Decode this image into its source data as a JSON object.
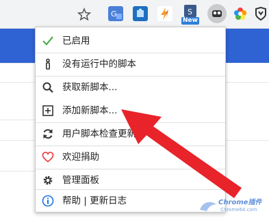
{
  "toolbar": {
    "extensions": [
      "bookmark-star-icon",
      "translate-extension-icon",
      "puzzle-extension-icon",
      "bolt-extension-icon",
      "new-extension-icon",
      "tampermonkey-extension-icon",
      "color-extension-icon",
      "shield-extension-icon"
    ],
    "new_badge": "New"
  },
  "menu": {
    "items": [
      {
        "label": "已启用",
        "icon": "check-icon"
      },
      {
        "label": "没有运行中的脚本",
        "icon": "info-i-icon"
      },
      {
        "label": "获取新脚本...",
        "icon": "search-icon"
      },
      {
        "label": "添加新脚本...",
        "icon": "plus-square-icon"
      },
      {
        "label": "用户脚本检查更新",
        "icon": "refresh-icon"
      },
      {
        "label": "欢迎捐助",
        "icon": "heart-icon"
      },
      {
        "label": "管理面板",
        "icon": "gear-icon"
      },
      {
        "label": "帮助 | 更新日志",
        "icon": "info-circle-icon"
      }
    ]
  },
  "watermark": {
    "title": "Chrome插件",
    "subtitle": "Chrome64.com"
  },
  "colors": {
    "check": "#4caf50",
    "heart": "#e8474b",
    "info": "#1a73e8",
    "arrow": "#e8232a",
    "band": "#2f63d4"
  }
}
